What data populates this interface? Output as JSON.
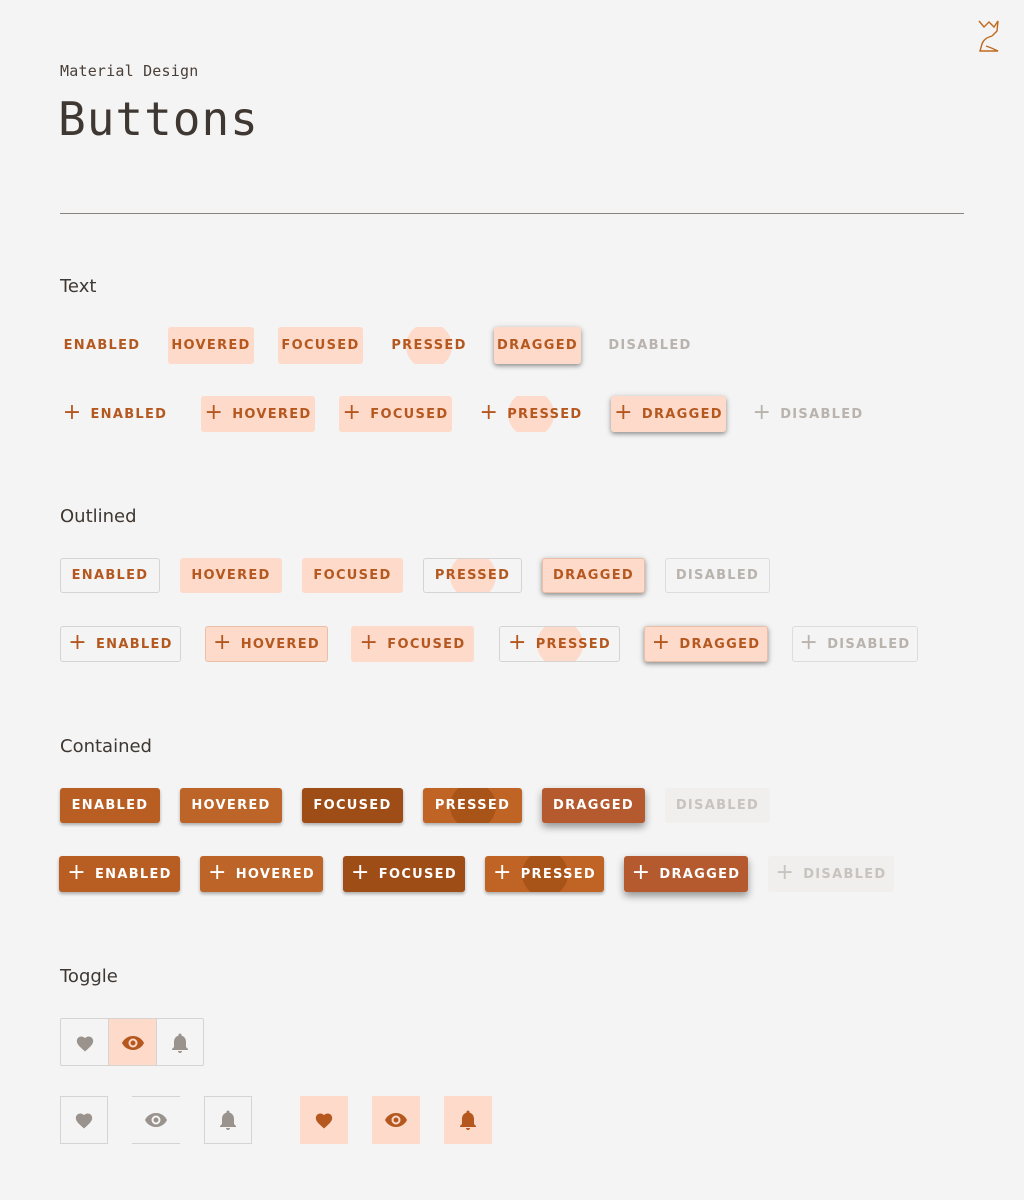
{
  "header": {
    "overline": "Material Design",
    "title": "Buttons"
  },
  "sections": {
    "text": "Text",
    "outlined": "Outlined",
    "contained": "Contained",
    "toggle": "Toggle"
  },
  "states": {
    "enabled": "ENABLED",
    "hovered": "HOVERED",
    "focused": "FOCUSED",
    "pressed": "PRESSED",
    "dragged": "DRAGGED",
    "disabled": "DISABLED"
  },
  "icons": {
    "logo": "fox-logo-icon",
    "plus": "+",
    "toggle": [
      "heart-icon",
      "eye-icon",
      "bell-icon"
    ]
  },
  "colors": {
    "background": "#f4f4f4",
    "primary": "#b95e22",
    "primary_text": "#b4581f",
    "state_overlay": "#fedacb",
    "disabled_text": "#b9b3ad",
    "icon_inactive": "#9a928c"
  }
}
